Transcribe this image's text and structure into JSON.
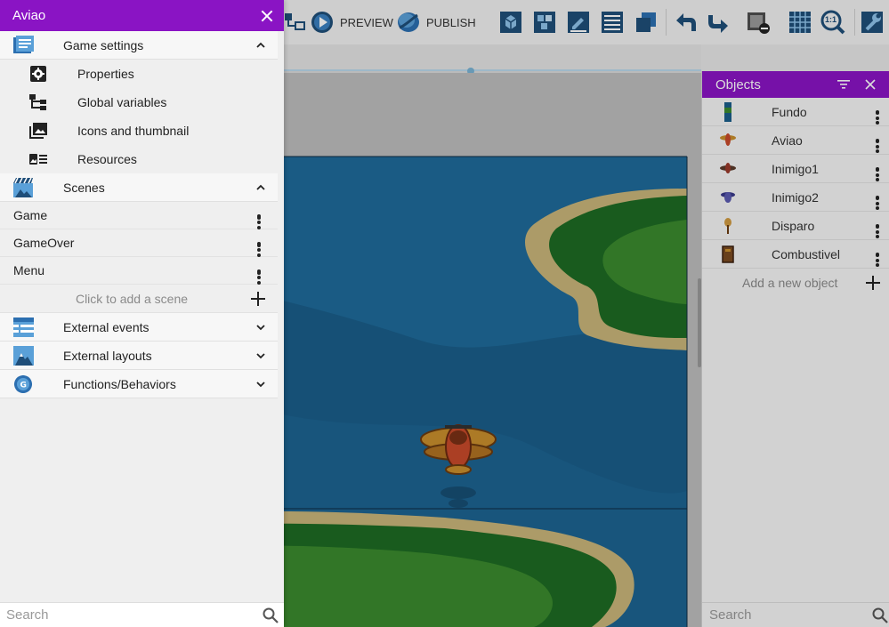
{
  "toolbar": {
    "preview_label": "PREVIEW",
    "publish_label": "PUBLISH",
    "zoom_label": "1:1"
  },
  "drawer": {
    "title": "Aviao",
    "sections": {
      "game_settings": "Game settings",
      "scenes": "Scenes",
      "external_events": "External events",
      "external_layouts": "External layouts",
      "functions": "Functions/Behaviors"
    },
    "game_settings_items": [
      "Properties",
      "Global variables",
      "Icons and thumbnail",
      "Resources"
    ],
    "scenes": [
      "Game",
      "GameOver",
      "Menu"
    ],
    "add_scene": "Click to add a scene",
    "search_placeholder": "Search"
  },
  "objects_panel": {
    "title": "Objects",
    "items": [
      "Fundo",
      "Aviao",
      "Inimigo1",
      "Inimigo2",
      "Disparo",
      "Combustivel"
    ],
    "add_label": "Add a new object",
    "search_placeholder": "Search"
  },
  "colors": {
    "accent": "#8a14c4",
    "ocean": "#1a5e8a",
    "ocean_deep": "#1e4e7a",
    "island_green": "#2e7d32",
    "sand": "#c9b57a"
  }
}
